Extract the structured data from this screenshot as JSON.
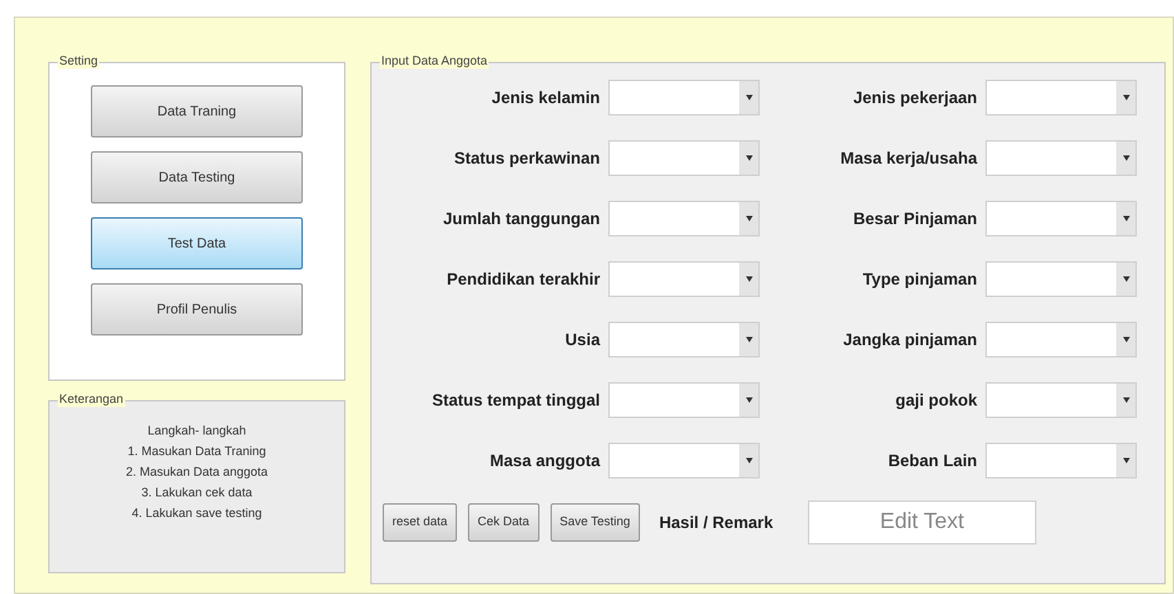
{
  "setting": {
    "title": "Setting",
    "buttons": [
      {
        "label": "Data Traning",
        "selected": false
      },
      {
        "label": "Data Testing",
        "selected": false
      },
      {
        "label": "Test Data",
        "selected": true
      },
      {
        "label": "Profil Penulis",
        "selected": false
      }
    ]
  },
  "keterangan": {
    "title": "Keterangan",
    "lines": [
      "Langkah- langkah",
      "1. Masukan Data Traning",
      "2. Masukan Data anggota",
      "3. Lakukan cek data",
      "4. Lakukan save testing"
    ]
  },
  "input": {
    "title": "Input Data Anggota",
    "rows": [
      {
        "left": "Jenis kelamin",
        "right": "Jenis pekerjaan"
      },
      {
        "left": "Status perkawinan",
        "right": "Masa kerja/usaha"
      },
      {
        "left": "Jumlah tanggungan",
        "right": "Besar Pinjaman"
      },
      {
        "left": "Pendidikan terakhir",
        "right": "Type pinjaman"
      },
      {
        "left": "Usia",
        "right": "Jangka pinjaman"
      },
      {
        "left": "Status tempat tinggal",
        "right": "gaji pokok"
      },
      {
        "left": "Masa anggota",
        "right": "Beban Lain"
      }
    ],
    "buttons": [
      "reset data",
      "Cek Data",
      "Save Testing"
    ],
    "result_label": "Hasil / Remark",
    "result_value": "Edit Text"
  }
}
